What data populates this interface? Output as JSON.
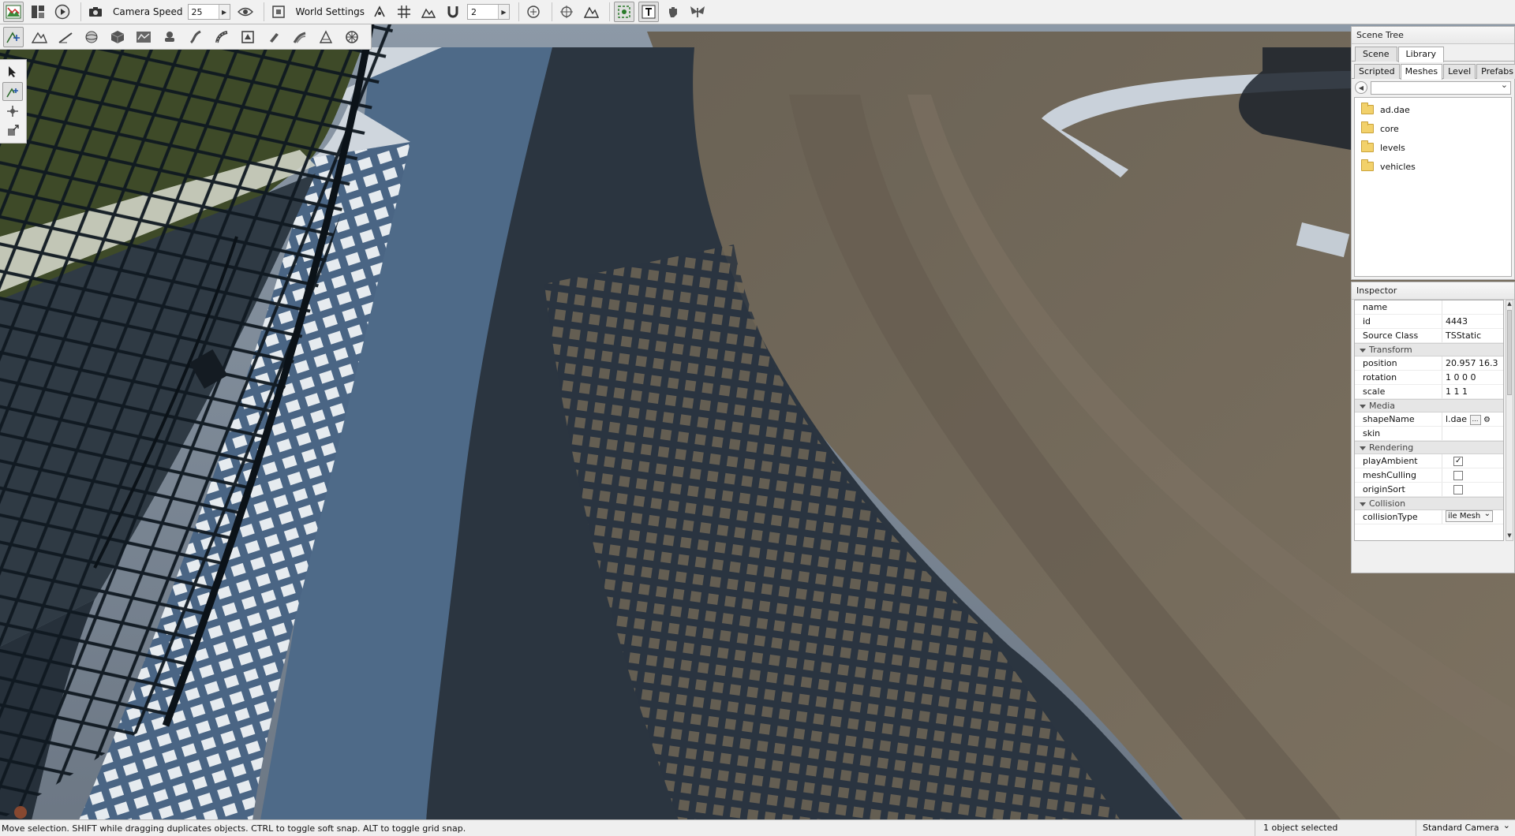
{
  "toolbar_top": {
    "camera_speed_label": "Camera Speed",
    "camera_speed_value": "25",
    "world_settings_label": "World Settings",
    "snap_value": "2"
  },
  "scene_tree": {
    "title": "Scene Tree",
    "tabs": [
      "Scene",
      "Library"
    ],
    "active_tab": "Library",
    "subtabs": [
      "Scripted",
      "Meshes",
      "Level",
      "Prefabs"
    ],
    "active_subtab": "Meshes",
    "items": [
      "ad.dae",
      "core",
      "levels",
      "vehicles"
    ]
  },
  "inspector": {
    "title": "Inspector",
    "name_label": "name",
    "name_value": "",
    "id_label": "id",
    "id_value": "4443",
    "source_class_label": "Source Class",
    "source_class_value": "TSStatic",
    "transform_group": "Transform",
    "position_label": "position",
    "position_value": "20.957 16.3",
    "rotation_label": "rotation",
    "rotation_value": "1 0 0 0",
    "scale_label": "scale",
    "scale_value": "1 1 1",
    "media_group": "Media",
    "shape_name_label": "shapeName",
    "shape_name_value": "l.dae",
    "skin_label": "skin",
    "rendering_group": "Rendering",
    "play_ambient_label": "playAmbient",
    "play_ambient_checked": true,
    "mesh_culling_label": "meshCulling",
    "mesh_culling_checked": false,
    "origin_sort_label": "originSort",
    "origin_sort_checked": false,
    "collision_group": "Collision",
    "collision_type_label": "collisionType",
    "collision_type_value": "ile Mesh"
  },
  "statusbar": {
    "message": "Move selection.  SHIFT while dragging duplicates objects.  CTRL to toggle soft snap.  ALT to toggle grid snap.",
    "selection": "1 object selected",
    "camera": "Standard Camera"
  },
  "colors": {
    "asphalt": "#2b3540",
    "dirt": "#6f6558",
    "apron": "#4e6a88",
    "grass": "#3e4a28",
    "fence": "#0f1820",
    "sky": "#7f8fa0",
    "ui_bg": "#f0f0f0"
  },
  "icons": {
    "toolbar_top": [
      "map-icon",
      "layout-icon",
      "play-icon",
      "camera-icon",
      "eye-icon",
      "camera-frame-icon",
      "snap-icon",
      "grid-icon",
      "terrain-snap-icon",
      "magnet-icon",
      "lock-icon",
      "target-icon",
      "ruler-icon",
      "selection-box-icon",
      "text-icon",
      "hand-icon",
      "butterfly-icon"
    ],
    "toolbar_second": [
      "object-editor-icon",
      "terrain-icon",
      "paint-icon",
      "sphere-icon",
      "cube-icon",
      "path-icon",
      "vehicle-icon",
      "river-icon",
      "road-icon",
      "forest-icon",
      "brush-icon",
      "mesh-road-icon",
      "decal-icon",
      "wheel-icon"
    ],
    "palette": [
      "select-arrow-icon",
      "move-icon",
      "rotate-icon",
      "scale-icon"
    ]
  }
}
